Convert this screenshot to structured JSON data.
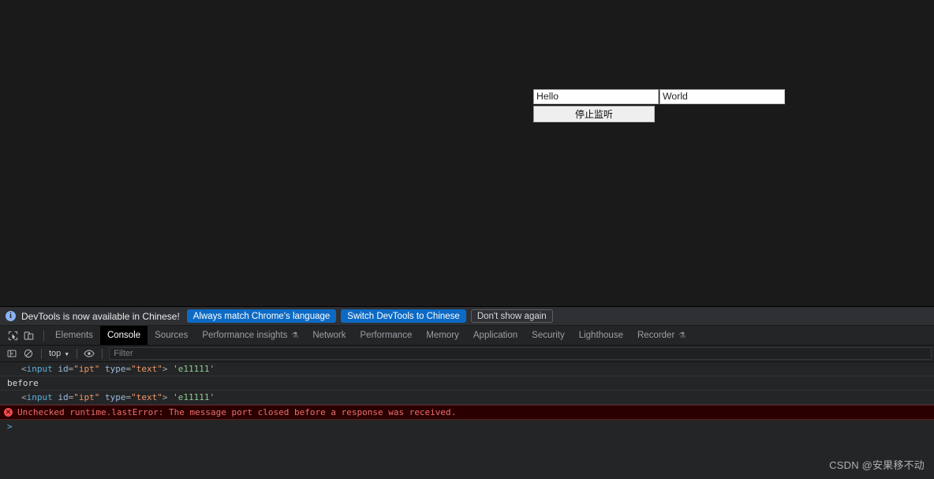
{
  "page": {
    "input_hello": {
      "value": "Hello"
    },
    "input_world": {
      "value": "World"
    },
    "stop_button_label": "停止监听"
  },
  "devtools": {
    "infobar": {
      "icon": "info-icon",
      "message": "DevTools is now available in Chinese!",
      "buttons": [
        {
          "label": "Always match Chrome's language",
          "style": "primary"
        },
        {
          "label": "Switch DevTools to Chinese",
          "style": "primary"
        },
        {
          "label": "Don't show again",
          "style": "ghost"
        }
      ]
    },
    "toolbar_icons": [
      {
        "name": "inspect-element-icon"
      },
      {
        "name": "device-toolbar-icon"
      }
    ],
    "tabs": [
      {
        "label": "Elements",
        "active": false,
        "badge": ""
      },
      {
        "label": "Console",
        "active": true,
        "badge": ""
      },
      {
        "label": "Sources",
        "active": false,
        "badge": ""
      },
      {
        "label": "Performance insights",
        "active": false,
        "badge": "⚗"
      },
      {
        "label": "Network",
        "active": false,
        "badge": ""
      },
      {
        "label": "Performance",
        "active": false,
        "badge": ""
      },
      {
        "label": "Memory",
        "active": false,
        "badge": ""
      },
      {
        "label": "Application",
        "active": false,
        "badge": ""
      },
      {
        "label": "Security",
        "active": false,
        "badge": ""
      },
      {
        "label": "Lighthouse",
        "active": false,
        "badge": ""
      },
      {
        "label": "Recorder",
        "active": false,
        "badge": "⚗"
      }
    ],
    "console_toolbar": {
      "sidebar_icon": "console-sidebar-icon",
      "clear_icon": "clear-console-icon",
      "context": "top",
      "eye_icon": "live-expression-eye-icon",
      "filter_placeholder": "Filter",
      "filter_value": ""
    },
    "console_log": {
      "rows": [
        {
          "type": "html",
          "indent": true,
          "tokens": [
            {
              "t": "punc",
              "s": "<"
            },
            {
              "t": "tag",
              "s": "input"
            },
            {
              "t": "plain",
              "s": " "
            },
            {
              "t": "attr",
              "s": "id"
            },
            {
              "t": "punc",
              "s": "="
            },
            {
              "t": "val",
              "s": "\"ipt\""
            },
            {
              "t": "plain",
              "s": " "
            },
            {
              "t": "attr",
              "s": "type"
            },
            {
              "t": "punc",
              "s": "="
            },
            {
              "t": "val",
              "s": "\"text\""
            },
            {
              "t": "punc",
              "s": ">"
            },
            {
              "t": "plain",
              "s": " "
            },
            {
              "t": "str",
              "s": "'e11111'"
            }
          ]
        },
        {
          "type": "plain",
          "indent": false,
          "tokens": [
            {
              "t": "plain",
              "s": "before"
            }
          ]
        },
        {
          "type": "html",
          "indent": true,
          "tokens": [
            {
              "t": "punc",
              "s": "<"
            },
            {
              "t": "tag",
              "s": "input"
            },
            {
              "t": "plain",
              "s": " "
            },
            {
              "t": "attr",
              "s": "id"
            },
            {
              "t": "punc",
              "s": "="
            },
            {
              "t": "val",
              "s": "\"ipt\""
            },
            {
              "t": "plain",
              "s": " "
            },
            {
              "t": "attr",
              "s": "type"
            },
            {
              "t": "punc",
              "s": "="
            },
            {
              "t": "val",
              "s": "\"text\""
            },
            {
              "t": "punc",
              "s": ">"
            },
            {
              "t": "plain",
              "s": " "
            },
            {
              "t": "str",
              "s": "'e11111'"
            }
          ]
        },
        {
          "type": "error",
          "indent": false,
          "text": "Unchecked runtime.lastError: The message port closed before a response was received."
        }
      ],
      "prompt_symbol": ">"
    }
  },
  "watermark": "CSDN @安果移不动",
  "colors": {
    "page_bg": "#1a1a1a",
    "devtools_bg": "#242527",
    "infobar_bg": "#2f3033",
    "accent_blue": "#0d6ac4",
    "error_bg": "#2a0000",
    "error_text": "#ef6d6d",
    "active_tab_bg": "#000000"
  }
}
